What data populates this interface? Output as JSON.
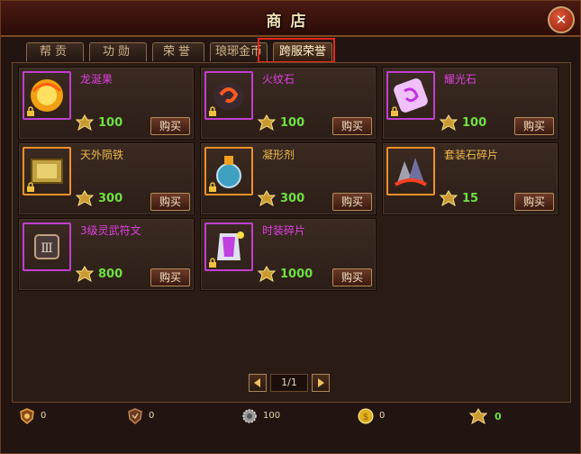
{
  "window": {
    "title": "商店",
    "close_label": "✕"
  },
  "tabs": [
    {
      "label": "帮贡",
      "active": false
    },
    {
      "label": "功勋",
      "active": false
    },
    {
      "label": "荣誉",
      "active": false
    },
    {
      "label": "琅琊金币",
      "active": false
    },
    {
      "label": "跨服荣誉",
      "active": true
    }
  ],
  "colors": {
    "name_purple": "#e040e0",
    "name_orange": "#f0b84a",
    "price": "#6fe040",
    "highlight": "#e8281c"
  },
  "items": [
    {
      "name": "龙涎果",
      "price": "100",
      "buy_label": "购买",
      "icon": "dragon-fruit-icon",
      "rarity": "purple",
      "locked": true
    },
    {
      "name": "火纹石",
      "price": "100",
      "buy_label": "购买",
      "icon": "fire-rune-stone-icon",
      "rarity": "purple",
      "locked": true
    },
    {
      "name": "耀光石",
      "price": "100",
      "buy_label": "购买",
      "icon": "radiant-stone-icon",
      "rarity": "purple",
      "locked": true
    },
    {
      "name": "天外陨铁",
      "price": "300",
      "buy_label": "购买",
      "icon": "meteor-iron-icon",
      "rarity": "orange",
      "locked": true
    },
    {
      "name": "凝形剂",
      "price": "300",
      "buy_label": "购买",
      "icon": "potion-icon",
      "rarity": "orange",
      "locked": true
    },
    {
      "name": "套装石碎片",
      "price": "15",
      "buy_label": "购买",
      "icon": "suit-stone-fragment-icon",
      "rarity": "orange",
      "locked": false
    },
    {
      "name": "3级灵武符文",
      "price": "800",
      "buy_label": "购买",
      "icon": "rune-tablet-icon",
      "rarity": "purple",
      "locked": false
    },
    {
      "name": "时装碎片",
      "price": "1000",
      "buy_label": "购买",
      "icon": "fashion-fragment-icon",
      "rarity": "purple",
      "locked": true
    }
  ],
  "pager": {
    "page": "1/1"
  },
  "footer": [
    {
      "icon": "guild-contribution-icon",
      "value": "0"
    },
    {
      "icon": "merit-medal-icon",
      "value": "0"
    },
    {
      "icon": "honor-gear-icon",
      "value": "100"
    },
    {
      "icon": "langya-coin-icon",
      "value": "0"
    },
    {
      "icon": "cross-server-honor-icon",
      "value": "0"
    }
  ]
}
